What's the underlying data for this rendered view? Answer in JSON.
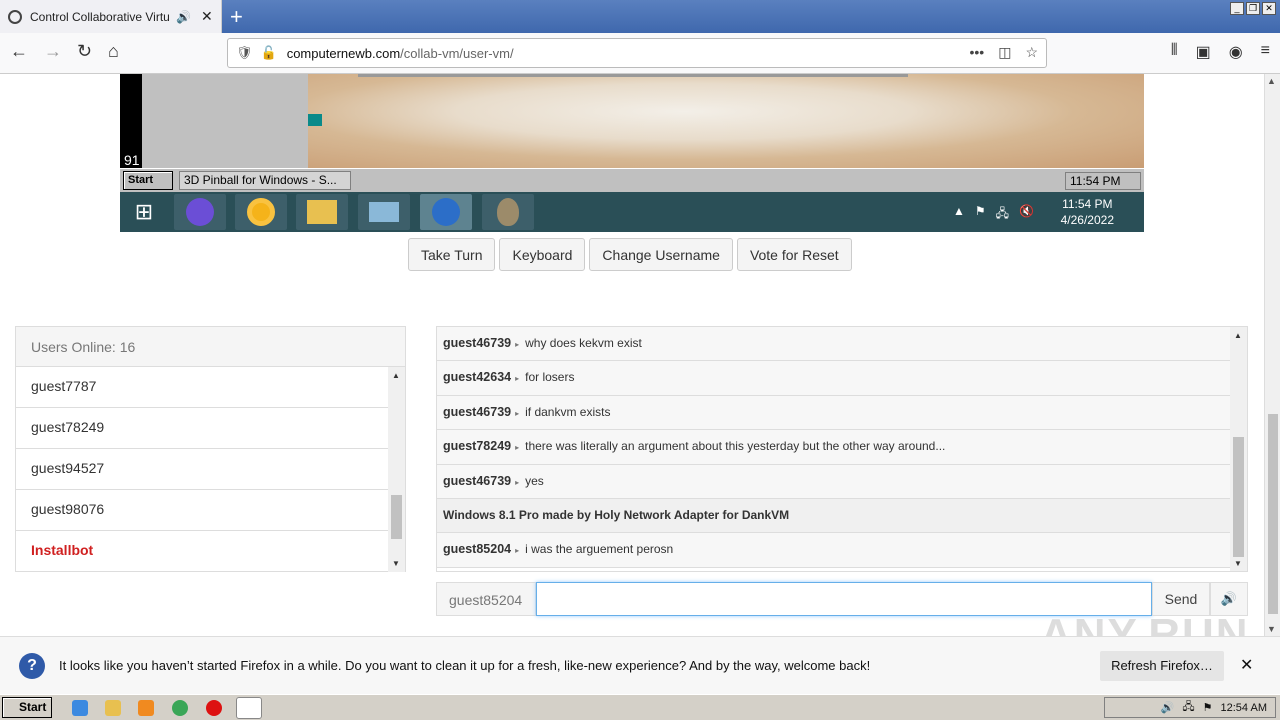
{
  "browser": {
    "tab_title": "Control Collaborative Virtual M",
    "url_domain": "computernewb.com",
    "url_path": "/collab-vm/user-vm/",
    "new_tab": "+",
    "tab_close": "✕",
    "page_actions": "•••"
  },
  "vm": {
    "side_number": "91",
    "win98_start": "Start",
    "win98_task": "3D Pinball for Windows - S...",
    "win98_clock": "11:54 PM",
    "win10_time": "11:54 PM",
    "win10_date": "4/26/2022"
  },
  "controls": {
    "take_turn": "Take Turn",
    "keyboard": "Keyboard",
    "change_username": "Change Username",
    "vote_reset": "Vote for Reset"
  },
  "users": {
    "header": "Users Online: 16",
    "items": [
      "guest7787",
      "guest78249",
      "guest94527",
      "guest98076",
      "Installbot"
    ]
  },
  "chat": {
    "messages": [
      {
        "user": "guest46739",
        "text": "why does kekvm exist"
      },
      {
        "user": "guest42634",
        "text": "for losers"
      },
      {
        "user": "guest46739",
        "text": "if dankvm exists"
      },
      {
        "user": "guest78249",
        "text": "there was literally an argument about this yesterday but the other way around..."
      },
      {
        "user": "guest46739",
        "text": "yes"
      },
      {
        "user": "",
        "text": "Windows 8.1 Pro made by Holy Network Adapter for DankVM"
      },
      {
        "user": "guest85204",
        "text": "i was the arguement perosn"
      }
    ],
    "username": "guest85204",
    "input_value": "",
    "send": "Send"
  },
  "notification": {
    "text": "It looks like you haven’t started Firefox in a while. Do you want to clean it up for a fresh, like-new experience? And by the way, welcome back!",
    "button": "Refresh Firefox…"
  },
  "watermark": "ANY.RUN",
  "taskbar": {
    "start": "Start",
    "clock": "12:54 AM"
  }
}
